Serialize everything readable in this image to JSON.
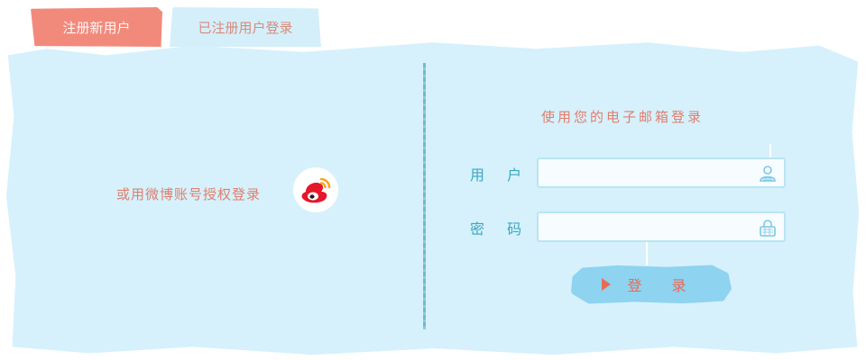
{
  "tabs": {
    "register": "注册新用户",
    "login": "已注册用户登录"
  },
  "left": {
    "weibo_text": "或用微博账号授权登录",
    "weibo_icon": "weibo-icon"
  },
  "right": {
    "title": "使用您的电子邮箱登录",
    "user_label": "用 户",
    "password_label": "密 码",
    "user_value": "",
    "password_value": "",
    "user_icon": "user-icon",
    "lock_icon": "lock-icon",
    "login_label": "登 录"
  },
  "colors": {
    "accent": "#f28a7c",
    "panel": "#d6f1fb",
    "label": "#3aa7c4",
    "button": "#8ed3f0"
  }
}
